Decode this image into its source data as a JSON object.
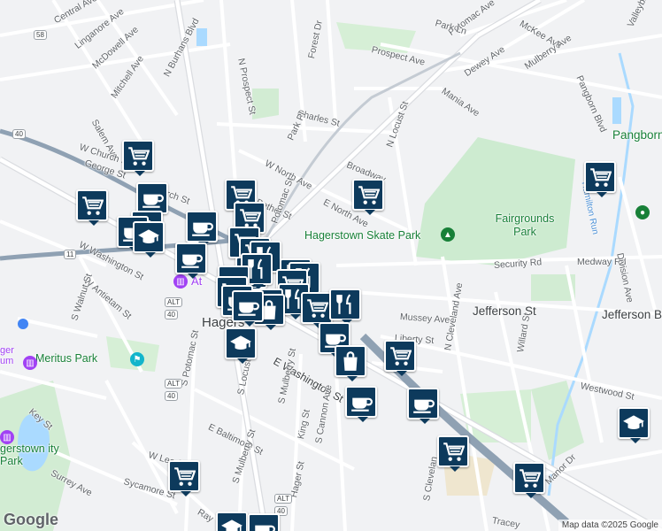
{
  "map": {
    "streets": [
      {
        "key": "central-ave",
        "text": "Central Ave"
      },
      {
        "key": "linganore-ave",
        "text": "Linganore Ave"
      },
      {
        "key": "mcdowell-ave",
        "text": "McDowell Ave"
      },
      {
        "key": "mitchell-ave",
        "text": "Mitchell Ave"
      },
      {
        "key": "n-burhans-blvd",
        "text": "N Burhans Blvd"
      },
      {
        "key": "salem-ave",
        "text": "Salem Ave"
      },
      {
        "key": "w-church-st",
        "text": "W Church St"
      },
      {
        "key": "george-st",
        "text": "George St"
      },
      {
        "key": "church-st",
        "text": "Church St"
      },
      {
        "key": "n-prospect-st",
        "text": "N Prospect St"
      },
      {
        "key": "forest-dr",
        "text": "Forest Dr"
      },
      {
        "key": "charles-st",
        "text": "Charles St"
      },
      {
        "key": "park-pl",
        "text": "Park Pl"
      },
      {
        "key": "w-north-ave",
        "text": "W North Ave"
      },
      {
        "key": "bethel-st",
        "text": "Bethel St"
      },
      {
        "key": "n-potomac-st",
        "text": "Potomac St"
      },
      {
        "key": "broadway",
        "text": "Broadway"
      },
      {
        "key": "n-locust-st",
        "text": "N Locust St"
      },
      {
        "key": "e-north-ave",
        "text": "E North Ave"
      },
      {
        "key": "prospect-ave",
        "text": "Prospect Ave"
      },
      {
        "key": "potomac-ave",
        "text": "Potomac Ave"
      },
      {
        "key": "park-ln",
        "text": "Park Ln"
      },
      {
        "key": "mckee-ave",
        "text": "McKee Ave"
      },
      {
        "key": "dewey-ave",
        "text": "Dewey Ave"
      },
      {
        "key": "mulberry-ave",
        "text": "Mulberry Ave"
      },
      {
        "key": "mania-ave",
        "text": "Mania Ave"
      },
      {
        "key": "pangborn-blvd",
        "text": "Pangborn Blvd"
      },
      {
        "key": "valley-blvd",
        "text": "Valleybro"
      },
      {
        "key": "w-washington-st",
        "text": "W Washington St"
      },
      {
        "key": "w-antietam-st",
        "text": "W Antietam St"
      },
      {
        "key": "s-walnut-st",
        "text": "S Walnut St"
      },
      {
        "key": "s-potomac-st",
        "text": "S Potomac St"
      },
      {
        "key": "s-locust-st",
        "text": "S Locust St"
      },
      {
        "key": "e-washington-st",
        "text": "E Washington St"
      },
      {
        "key": "s-mulberry-st",
        "text": "S Mulberry St"
      },
      {
        "key": "e-baltimore-st",
        "text": "E Baltimore St"
      },
      {
        "key": "king-st",
        "text": "King St"
      },
      {
        "key": "hager-st",
        "text": "Hager St"
      },
      {
        "key": "w-lee-st",
        "text": "W Lee St"
      },
      {
        "key": "sycamore-st",
        "text": "Sycamore St"
      },
      {
        "key": "surrey-ave",
        "text": "Surrey Ave"
      },
      {
        "key": "key-st",
        "text": "Key St"
      },
      {
        "key": "s-mulberry-st-2",
        "text": "S Mulberry St"
      },
      {
        "key": "s-cannon-ave",
        "text": "S Cannon Ave"
      },
      {
        "key": "mussey-ave",
        "text": "Mussey Ave"
      },
      {
        "key": "liberty-st",
        "text": "Liberty St"
      },
      {
        "key": "jefferson-st",
        "text": "Jefferson St"
      },
      {
        "key": "jefferson-blvd",
        "text": "Jefferson Bl"
      },
      {
        "key": "n-cleveland-ave",
        "text": "N Cleveland Ave"
      },
      {
        "key": "s-cleveland-ave",
        "text": "S Clevelan"
      },
      {
        "key": "security-rd",
        "text": "Security Rd"
      },
      {
        "key": "medway-rd",
        "text": "Medway Rd"
      },
      {
        "key": "division-ave",
        "text": "Division Ave"
      },
      {
        "key": "willard-st",
        "text": "Willard St"
      },
      {
        "key": "westwood-st",
        "text": "Westwood St"
      },
      {
        "key": "manor-dr",
        "text": "Manor Dr"
      },
      {
        "key": "tracey",
        "text": "Tracey"
      },
      {
        "key": "ray",
        "text": "Ray"
      },
      {
        "key": "pangborn",
        "text": "Pangborn"
      },
      {
        "key": "hamilton-run",
        "text": "Hamilton Run"
      }
    ],
    "places": [
      {
        "key": "hagerstown",
        "text": "Hagers"
      },
      {
        "key": "fairgrounds-park",
        "text": "Fairgrounds Park"
      },
      {
        "key": "skate-park",
        "text": "Hagerstown Skate Park"
      },
      {
        "key": "meritus-park",
        "text": "Meritus Park"
      },
      {
        "key": "museum",
        "text": "ger um"
      },
      {
        "key": "city-park",
        "text": "gerstown ity Park"
      },
      {
        "key": "at",
        "text": "At"
      }
    ],
    "shields": {
      "r58": "58",
      "r40": "40",
      "r11": "11",
      "alt40a": "ALT",
      "n40a": "40",
      "alt40b": "ALT",
      "n40b": "40",
      "alt40c": "ALT",
      "n40c": "40"
    },
    "attribution": "Map data ©2025 Google",
    "logo": "Google"
  }
}
